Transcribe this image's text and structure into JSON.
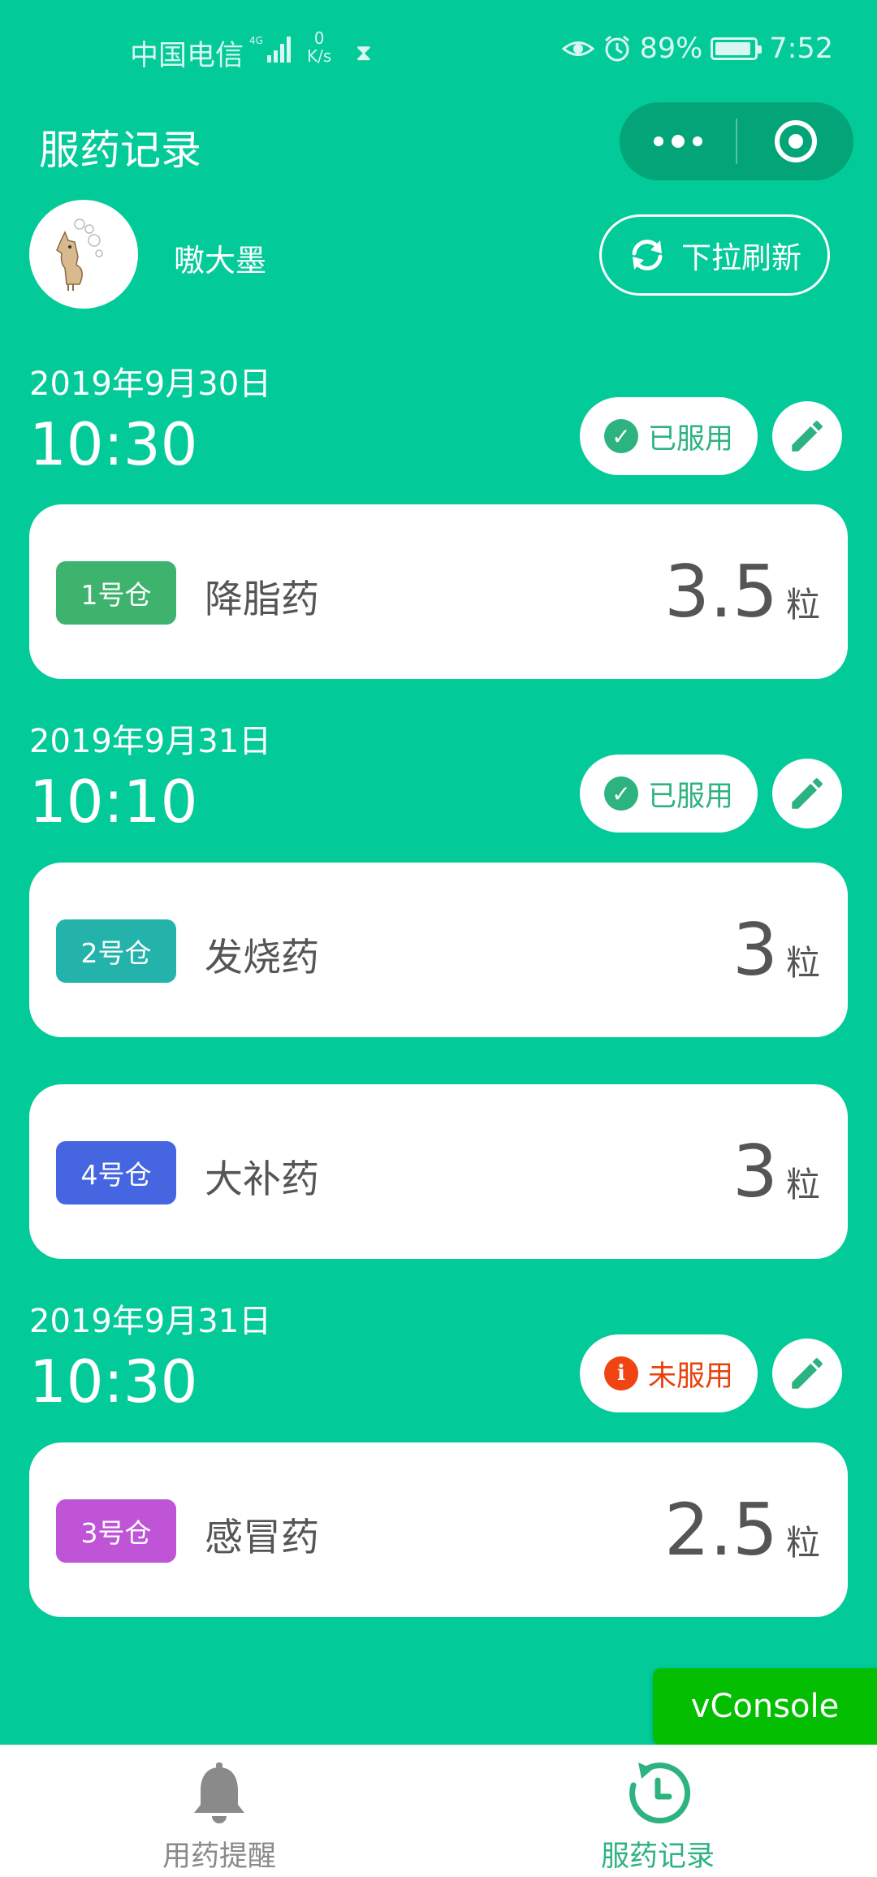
{
  "status_bar": {
    "carrier": "中国电信",
    "network": "4G",
    "net_speed_value": "0",
    "net_speed_unit": "K/s",
    "battery": "89%",
    "battery_level": 0.89,
    "time": "7:52"
  },
  "header": {
    "title": "服药记录"
  },
  "user": {
    "name": "嗷大墨",
    "refresh_label": "下拉刷新"
  },
  "records": [
    {
      "date": "2019年9月30日",
      "time": "10:30",
      "status": "已服用",
      "status_type": "taken",
      "items": [
        {
          "bin": "1号仓",
          "bin_color": "#3DB36E",
          "name": "降脂药",
          "dose": "3.5",
          "unit": "粒"
        }
      ]
    },
    {
      "date": "2019年9月31日",
      "time": "10:10",
      "status": "已服用",
      "status_type": "taken",
      "items": [
        {
          "bin": "2号仓",
          "bin_color": "#23B3AB",
          "name": "发烧药",
          "dose": "3",
          "unit": "粒"
        },
        {
          "bin": "4号仓",
          "bin_color": "#4566E0",
          "name": "大补药",
          "dose": "3",
          "unit": "粒"
        }
      ]
    },
    {
      "date": "2019年9月31日",
      "time": "10:30",
      "status": "未服用",
      "status_type": "missed",
      "items": [
        {
          "bin": "3号仓",
          "bin_color": "#BF55D6",
          "name": "感冒药",
          "dose": "2.5",
          "unit": "粒"
        }
      ]
    }
  ],
  "vconsole_label": "vConsole",
  "tabbar": {
    "tabs": [
      {
        "label": "用药提醒",
        "icon": "bell-icon",
        "active": false
      },
      {
        "label": "服药记录",
        "icon": "history-clock-icon",
        "active": true
      }
    ],
    "active_color": "#2DB37F",
    "inactive_color": "#8A8A8A"
  },
  "colors": {
    "background": "#02CA98",
    "taken": "#2DB37F",
    "missed": "#F04413"
  }
}
